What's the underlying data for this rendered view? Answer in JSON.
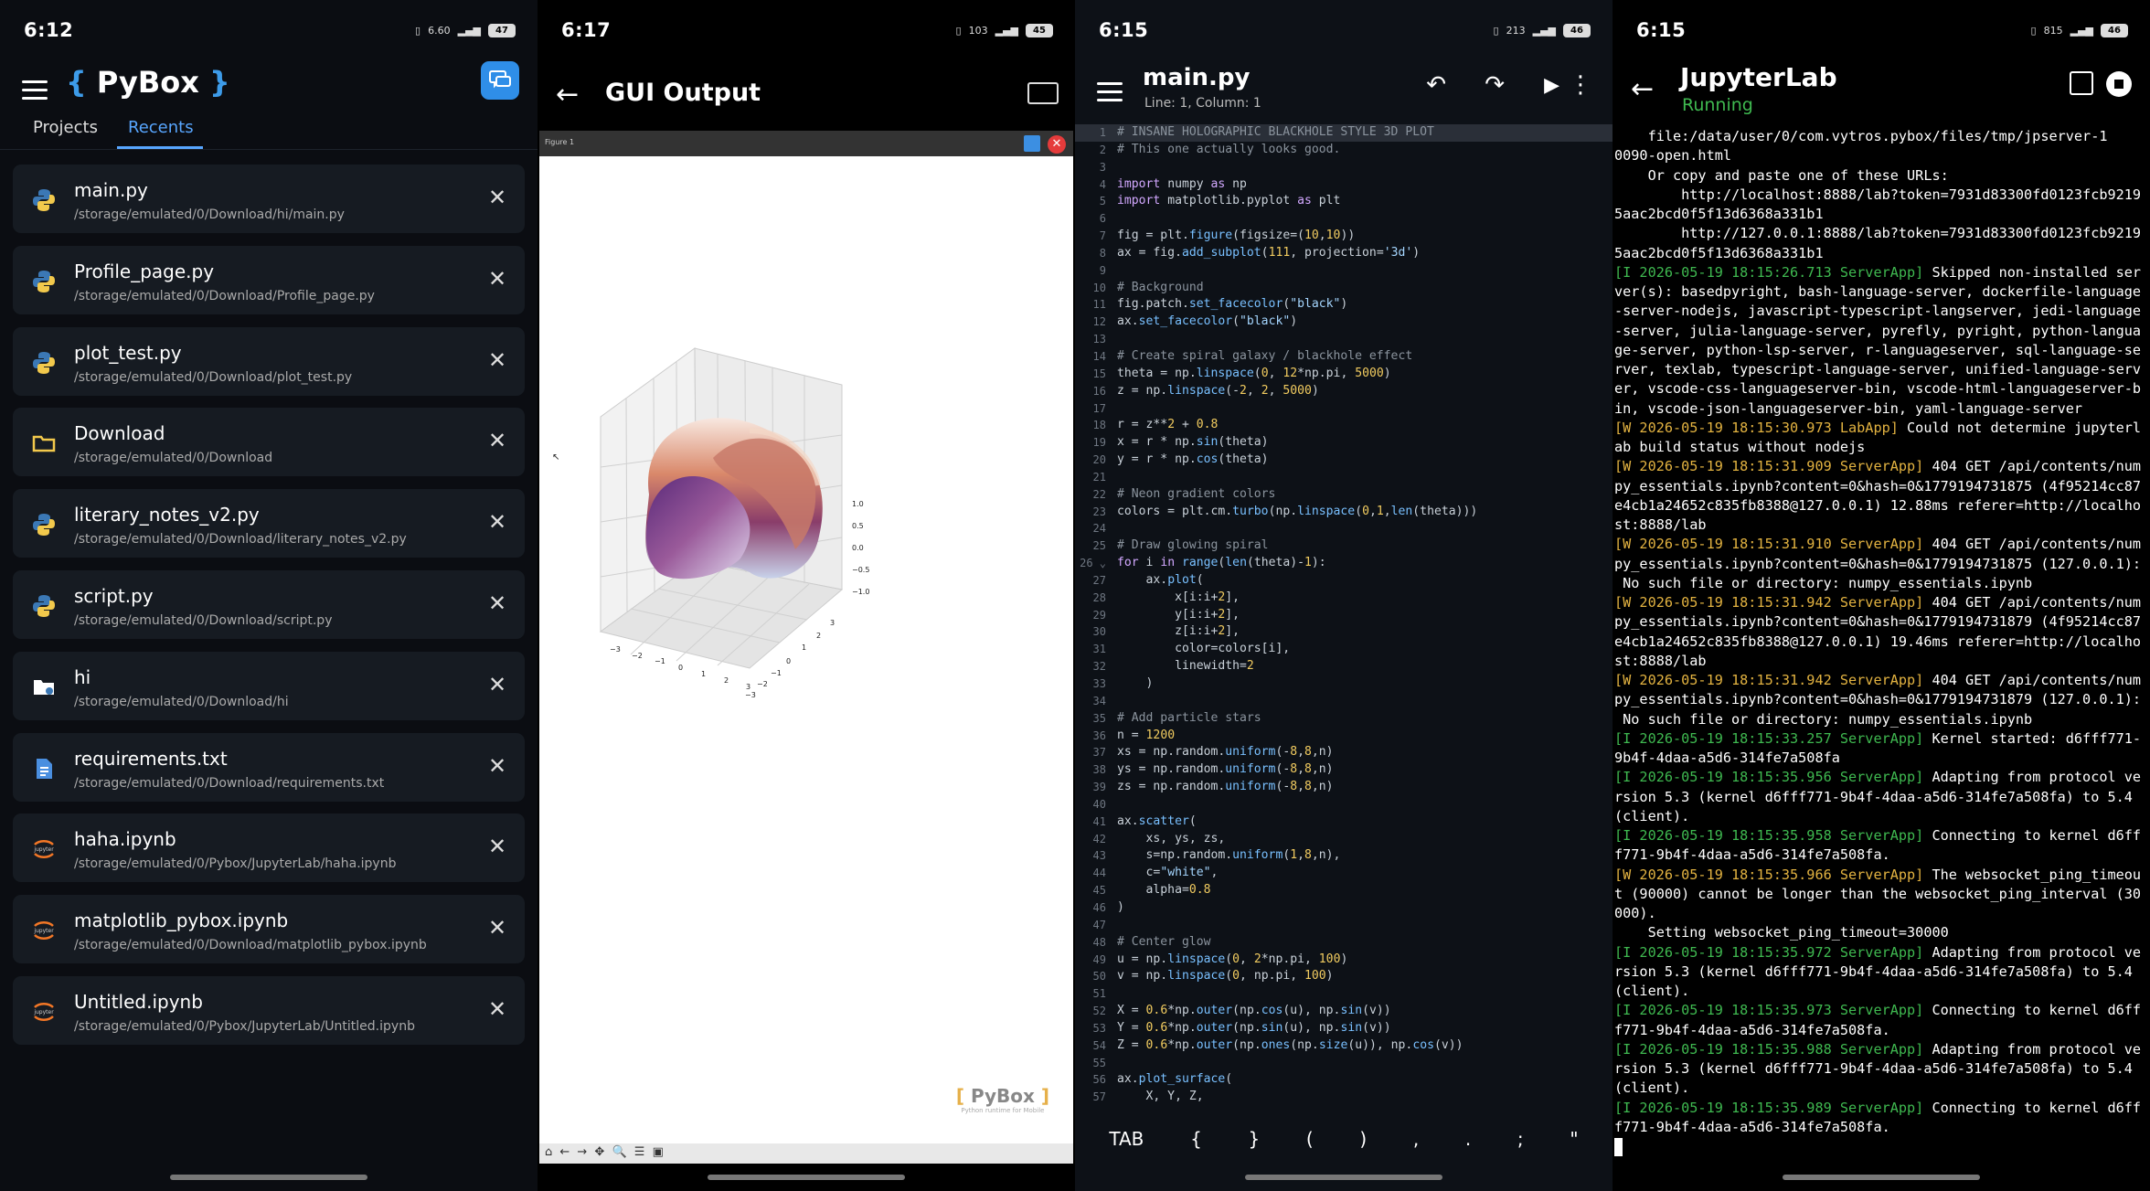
{
  "screens": {
    "recents": {
      "status_time": "6:12",
      "network": "6.60",
      "battery": "47",
      "logo_text": "PyBox",
      "tabs": [
        "Projects",
        "Recents"
      ],
      "files": [
        {
          "name": "main.py",
          "path": "/storage/emulated/0/Download/hi/main.py",
          "icon": "python-icon"
        },
        {
          "name": "Profile_page.py",
          "path": "/storage/emulated/0/Download/Profile_page.py",
          "icon": "python-icon"
        },
        {
          "name": "plot_test.py",
          "path": "/storage/emulated/0/Download/plot_test.py",
          "icon": "python-icon"
        },
        {
          "name": "Download",
          "path": "/storage/emulated/0/Download",
          "icon": "folder-icon"
        },
        {
          "name": "literary_notes_v2.py",
          "path": "/storage/emulated/0/Download/literary_notes_v2.py",
          "icon": "python-icon"
        },
        {
          "name": "script.py",
          "path": "/storage/emulated/0/Download/script.py",
          "icon": "python-icon"
        },
        {
          "name": "hi",
          "path": "/storage/emulated/0/Download/hi",
          "icon": "project-folder-icon"
        },
        {
          "name": "requirements.txt",
          "path": "/storage/emulated/0/Download/requirements.txt",
          "icon": "document-icon"
        },
        {
          "name": "haha.ipynb",
          "path": "/storage/emulated/0/Pybox/JupyterLab/haha.ipynb",
          "icon": "jupyter-icon"
        },
        {
          "name": "matplotlib_pybox.ipynb",
          "path": "/storage/emulated/0/Download/matplotlib_pybox.ipynb",
          "icon": "jupyter-icon"
        },
        {
          "name": "Untitled.ipynb",
          "path": "/storage/emulated/0/Pybox/JupyterLab/Untitled.ipynb",
          "icon": "jupyter-icon"
        }
      ]
    },
    "gui_output": {
      "status_time": "6:17",
      "network": "103",
      "battery": "45",
      "title": "GUI Output",
      "figure_title": "Figure 1",
      "watermark_logo": "PyBox",
      "watermark_tagline": "Python runtime for Mobile",
      "x_ticks": [
        "−3",
        "−2",
        "−1",
        "0",
        "1",
        "2",
        "3"
      ],
      "y_ticks": [
        "3",
        "2",
        "1",
        "0",
        "−1",
        "−2",
        "−3"
      ],
      "z_ticks": [
        "1.0",
        "0.5",
        "0.0",
        "−0.5",
        "−1.0"
      ],
      "toolbar_glyphs": "⌂ ← → ✥ 🔍 ☰  ▣"
    },
    "editor": {
      "status_time": "6:15",
      "network": "213",
      "battery": "46",
      "title": "main.py",
      "cursor_info": "Line: 1, Column: 1",
      "code": [
        "# INSANE HOLOGRAPHIC BLACKHOLE STYLE 3D PLOT",
        "# This one actually looks good.",
        "",
        "import numpy as np",
        "import matplotlib.pyplot as plt",
        "",
        "fig = plt.figure(figsize=(10,10))",
        "ax = fig.add_subplot(111, projection='3d')",
        "",
        "# Background",
        "fig.patch.set_facecolor(\"black\")",
        "ax.set_facecolor(\"black\")",
        "",
        "# Create spiral galaxy / blackhole effect",
        "theta = np.linspace(0, 12*np.pi, 5000)",
        "z = np.linspace(-2, 2, 5000)",
        "",
        "r = z**2 + 0.8",
        "x = r * np.sin(theta)",
        "y = r * np.cos(theta)",
        "",
        "# Neon gradient colors",
        "colors = plt.cm.turbo(np.linspace(0,1,len(theta)))",
        "",
        "# Draw glowing spiral",
        "for i in range(len(theta)-1):",
        "    ax.plot(",
        "        x[i:i+2],",
        "        y[i:i+2],",
        "        z[i:i+2],",
        "        color=colors[i],",
        "        linewidth=2",
        "    )",
        "",
        "# Add particle stars",
        "n = 1200",
        "xs = np.random.uniform(-8,8,n)",
        "ys = np.random.uniform(-8,8,n)",
        "zs = np.random.uniform(-8,8,n)",
        "",
        "ax.scatter(",
        "    xs, ys, zs,",
        "    s=np.random.uniform(1,8,n),",
        "    c=\"white\",",
        "    alpha=0.8",
        ")",
        "",
        "# Center glow",
        "u = np.linspace(0, 2*np.pi, 100)",
        "v = np.linspace(0, np.pi, 100)",
        "",
        "X = 0.6*np.outer(np.cos(u), np.sin(v))",
        "Y = 0.6*np.outer(np.sin(u), np.sin(v))",
        "Z = 0.6*np.outer(np.ones(np.size(u)), np.cos(v))",
        "",
        "ax.plot_surface(",
        "    X, Y, Z,"
      ],
      "fold_marker": "⌄",
      "keys": [
        "TAB",
        "{",
        "}",
        "(",
        ")",
        ",",
        ".",
        ";",
        "\""
      ]
    },
    "jupyter": {
      "status_time": "6:15",
      "network": "815",
      "battery": "46",
      "title": "JupyterLab",
      "status": "Running",
      "log": [
        [
          "",
          "    file:/data/user/0/com.vytros.pybox/files/tmp/jpserver-1"
        ],
        [
          "",
          "0090-open.html"
        ],
        [
          "",
          "    Or copy and paste one of these URLs:"
        ],
        [
          "",
          "        http://localhost:8888/lab?token=7931d83300fd0123fcb9219"
        ],
        [
          "",
          "5aac2bcd0f5f13d6368a331b1"
        ],
        [
          "",
          "        http://127.0.0.1:8888/lab?token=7931d83300fd0123fcb9219"
        ],
        [
          "",
          "5aac2bcd0f5f13d6368a331b1"
        ],
        [
          "i",
          "[I 2026-05-19 18:15:26.713 ServerApp]",
          " Skipped non-installed ser"
        ],
        [
          "",
          "ver(s): basedpyright, bash-language-server, dockerfile-language"
        ],
        [
          "",
          "-server-nodejs, javascript-typescript-langserver, jedi-language"
        ],
        [
          "",
          "-server, julia-language-server, pyrefly, pyright, python-langua"
        ],
        [
          "",
          "ge-server, python-lsp-server, r-languageserver, sql-language-se"
        ],
        [
          "",
          "rver, texlab, typescript-language-server, unified-language-serv"
        ],
        [
          "",
          "er, vscode-css-languageserver-bin, vscode-html-languageserver-b"
        ],
        [
          "",
          "in, vscode-json-languageserver-bin, yaml-language-server"
        ],
        [
          "w",
          "[W 2026-05-19 18:15:30.973 LabApp]",
          " Could not determine jupyterl"
        ],
        [
          "",
          "ab build status without nodejs"
        ],
        [
          "w",
          "[W 2026-05-19 18:15:31.909 ServerApp]",
          " 404 GET /api/contents/num"
        ],
        [
          "",
          "py_essentials.ipynb?content=0&hash=0&1779194731875 (4f95214cc87"
        ],
        [
          "",
          "e4cb1a24652c835fb8388@127.0.0.1) 12.88ms referer=http://localho"
        ],
        [
          "",
          "st:8888/lab"
        ],
        [
          "w",
          "[W 2026-05-19 18:15:31.910 ServerApp]",
          " 404 GET /api/contents/num"
        ],
        [
          "",
          "py_essentials.ipynb?content=0&hash=0&1779194731875 (127.0.0.1):"
        ],
        [
          "",
          " No such file or directory: numpy_essentials.ipynb"
        ],
        [
          "w",
          "[W 2026-05-19 18:15:31.942 ServerApp]",
          " 404 GET /api/contents/num"
        ],
        [
          "",
          "py_essentials.ipynb?content=0&hash=0&1779194731879 (4f95214cc87"
        ],
        [
          "",
          "e4cb1a24652c835fb8388@127.0.0.1) 19.46ms referer=http://localho"
        ],
        [
          "",
          "st:8888/lab"
        ],
        [
          "w",
          "[W 2026-05-19 18:15:31.942 ServerApp]",
          " 404 GET /api/contents/num"
        ],
        [
          "",
          "py_essentials.ipynb?content=0&hash=0&1779194731879 (127.0.0.1):"
        ],
        [
          "",
          " No such file or directory: numpy_essentials.ipynb"
        ],
        [
          "i",
          "[I 2026-05-19 18:15:33.257 ServerApp]",
          " Kernel started: d6fff771-"
        ],
        [
          "",
          "9b4f-4daa-a5d6-314fe7a508fa"
        ],
        [
          "i",
          "[I 2026-05-19 18:15:35.956 ServerApp]",
          " Adapting from protocol ve"
        ],
        [
          "",
          "rsion 5.3 (kernel d6fff771-9b4f-4daa-a5d6-314fe7a508fa) to 5.4"
        ],
        [
          "",
          "(client)."
        ],
        [
          "i",
          "[I 2026-05-19 18:15:35.958 ServerApp]",
          " Connecting to kernel d6ff"
        ],
        [
          "",
          "f771-9b4f-4daa-a5d6-314fe7a508fa."
        ],
        [
          "w",
          "[W 2026-05-19 18:15:35.966 ServerApp]",
          " The websocket_ping_timeou"
        ],
        [
          "",
          "t (90000) cannot be longer than the websocket_ping_interval (30"
        ],
        [
          "",
          "000)."
        ],
        [
          "",
          "    Setting websocket_ping_timeout=30000"
        ],
        [
          "i",
          "[I 2026-05-19 18:15:35.972 ServerApp]",
          " Adapting from protocol ve"
        ],
        [
          "",
          "rsion 5.3 (kernel d6fff771-9b4f-4daa-a5d6-314fe7a508fa) to 5.4"
        ],
        [
          "",
          "(client)."
        ],
        [
          "i",
          "[I 2026-05-19 18:15:35.973 ServerApp]",
          " Connecting to kernel d6ff"
        ],
        [
          "",
          "f771-9b4f-4daa-a5d6-314fe7a508fa."
        ],
        [
          "i",
          "[I 2026-05-19 18:15:35.988 ServerApp]",
          " Adapting from protocol ve"
        ],
        [
          "",
          "rsion 5.3 (kernel d6fff771-9b4f-4daa-a5d6-314fe7a508fa) to 5.4"
        ],
        [
          "",
          "(client)."
        ],
        [
          "i",
          "[I 2026-05-19 18:15:35.989 ServerApp]",
          " Connecting to kernel d6ff"
        ],
        [
          "",
          "f771-9b4f-4daa-a5d6-314fe7a508fa."
        ]
      ]
    }
  },
  "colors": {
    "accent": "#58a6ff",
    "running": "#3fb950",
    "warn": "#e3b341",
    "close": "#e53b3b"
  }
}
